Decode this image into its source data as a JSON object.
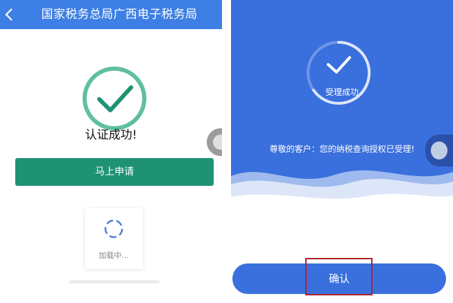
{
  "left_screen": {
    "header": {
      "title": "国家税务总局广西电子税务局",
      "back_icon": "chevron-left-icon"
    },
    "success_icon": "check-circle-icon",
    "success_text": "认证成功!",
    "apply_button_label": "马上申请",
    "loading_text": "加载中...",
    "colors": {
      "header": "#3d7fe4",
      "accent_green": "#1f9274",
      "check_green": "#5fbf9f"
    }
  },
  "right_screen": {
    "status_label": "受理成功",
    "status_icon": "check-icon",
    "message": "尊敬的客户：您的纳税查询授权已受理!",
    "confirm_button_label": "确认",
    "colors": {
      "background_blue": "#3a70dd",
      "highlight_border": "#b0202c"
    }
  }
}
